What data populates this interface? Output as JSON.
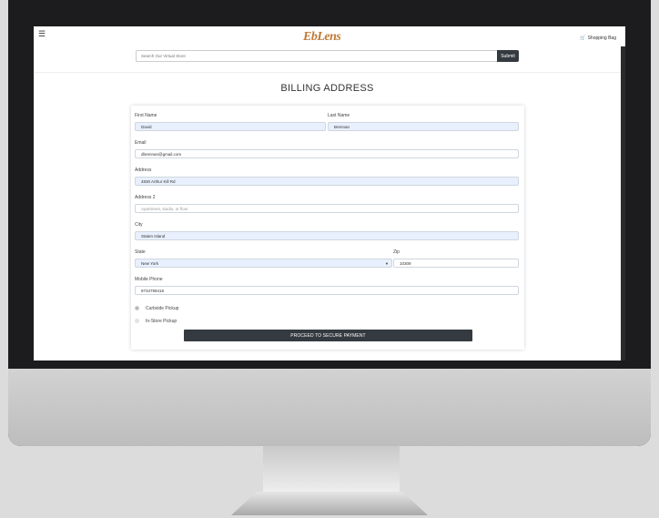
{
  "header": {
    "menu_icon": "hamburger-icon",
    "logo_text": "EbLens",
    "cart_label": "Shopping Bag",
    "cart_icon": "shopping-cart-icon"
  },
  "search": {
    "placeholder": "Search Our Virtual Store",
    "value": "",
    "submit_label": "Submit"
  },
  "billing": {
    "title": "BILLING ADDRESS",
    "first_name": {
      "label": "First Name",
      "value": "David"
    },
    "last_name": {
      "label": "Last Name",
      "value": "Brennan"
    },
    "email": {
      "label": "Email",
      "value": "dbrennan@gmail.com"
    },
    "address": {
      "label": "Address",
      "value": "4830 Arthur Kill Rd"
    },
    "address2": {
      "label": "Address 2",
      "placeholder": "Apartment, studio, or floor"
    },
    "city": {
      "label": "City",
      "value": "Staten Island"
    },
    "state": {
      "label": "State",
      "value": "New York"
    },
    "zip": {
      "label": "Zip",
      "value": "10309"
    },
    "phone": {
      "label": "Mobile Phone",
      "value": "9734799418"
    },
    "pickup_options": [
      {
        "label": "Curbside Pickup",
        "selected": true
      },
      {
        "label": "In-Store Pickup",
        "selected": false
      }
    ],
    "submit_label": "PROCEED TO SECURE PAYMENT"
  },
  "colors": {
    "logo": "#c07a36",
    "button": "#343a40",
    "autofill": "#e8f0fe"
  }
}
